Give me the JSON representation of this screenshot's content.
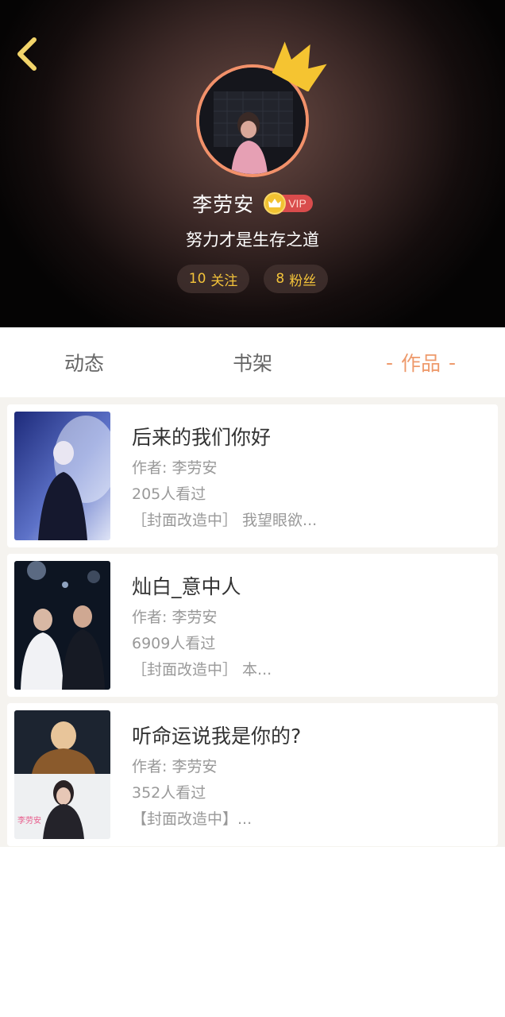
{
  "header": {
    "username": "李劳安",
    "vip_label": "VIP",
    "motto": "努力才是生存之道",
    "stats": {
      "following_count": "10",
      "following_label": "关注",
      "fans_count": "8",
      "fans_label": "粉丝"
    }
  },
  "tabs": [
    {
      "label": "动态",
      "active": false
    },
    {
      "label": "书架",
      "active": false
    },
    {
      "label": "作品",
      "active": true,
      "dash": "-"
    }
  ],
  "works": [
    {
      "title": "后来的我们你好",
      "author": "作者: 李劳安",
      "views": "205人看过",
      "desc": "［封面改造中］ 我望眼欲..."
    },
    {
      "title": "灿白_意中人",
      "author": "作者: 李劳安",
      "views": "6909人看过",
      "desc": "［封面改造中］ 本..."
    },
    {
      "title": "听命运说我是你的?",
      "author": "作者: 李劳安",
      "views": "352人看过",
      "desc": "【封面改造中】..."
    }
  ],
  "cover3_watermark": "李劳安",
  "colors": {
    "accent": "#ee9a6c",
    "stat_text": "#f3c33a",
    "avatar_ring": "#f2916a",
    "crown": "#f5c431",
    "vip_badge": "#d94c4c"
  },
  "icons": [
    "chevron-left-icon",
    "crown-icon",
    "vip-crown-icon"
  ]
}
